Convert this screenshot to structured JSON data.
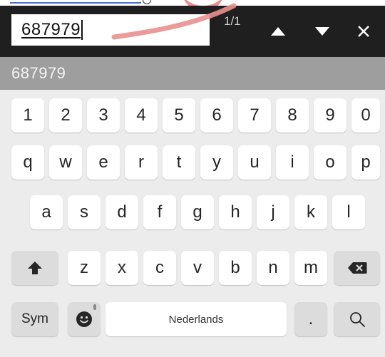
{
  "find_bar": {
    "query": "687979",
    "match_count": "1/1",
    "icons": {
      "up": "arrow-up-icon",
      "down": "arrow-down-icon",
      "close": "close-icon"
    }
  },
  "suggestion_strip": {
    "suggestion": "687979"
  },
  "keyboard": {
    "number_row": [
      "1",
      "2",
      "3",
      "4",
      "5",
      "6",
      "7",
      "8",
      "9",
      "0"
    ],
    "row1": [
      "q",
      "w",
      "e",
      "r",
      "t",
      "y",
      "u",
      "i",
      "o",
      "p"
    ],
    "row2": [
      "a",
      "s",
      "d",
      "f",
      "g",
      "h",
      "j",
      "k",
      "l"
    ],
    "row3": [
      "z",
      "x",
      "c",
      "v",
      "b",
      "n",
      "m"
    ],
    "sym_label": "Sym",
    "space_label": "Nederlands",
    "period_label": ".",
    "icons": {
      "shift": "shift-icon",
      "backspace": "backspace-icon",
      "emoji": "emoji-icon",
      "search": "search-icon"
    }
  },
  "colors": {
    "find_bar_bg": "#1f1f1f",
    "suggestion_bg": "#9e9e9e",
    "keyboard_bg": "#ececec",
    "key_bg": "#ffffff",
    "func_key_bg": "#dcdcdc",
    "annotation_stroke": "#e9908f"
  }
}
